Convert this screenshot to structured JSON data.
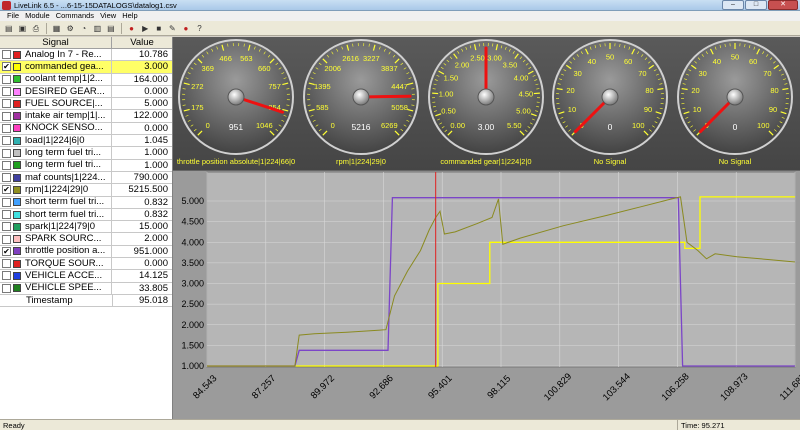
{
  "window": {
    "title": "LiveLink 6.5 - ...6-15-15DATALOGS\\datalog1.csv",
    "minimize": "–",
    "maximize": "□",
    "close": "✕"
  },
  "menu": [
    "File",
    "Module",
    "Commands",
    "View",
    "Help"
  ],
  "toolbar_icons": [
    "open-icon",
    "save-icon",
    "print-icon",
    "chart-icon",
    "config-icon",
    "gauge-icon",
    "table-icon",
    "log-icon",
    "record-icon",
    "play-icon",
    "stop-icon",
    "settings-icon",
    "record-dot-icon",
    "help-icon"
  ],
  "signal_table": {
    "headers": {
      "signal": "Signal",
      "value": "Value"
    },
    "rows": [
      {
        "checked": false,
        "color": "#e02020",
        "name": "Analog In 7 - Re...",
        "value": "10.786"
      },
      {
        "checked": true,
        "color": "#ffff00",
        "name": "commanded gea...",
        "value": "3.000",
        "selected": true
      },
      {
        "checked": false,
        "color": "#30c030",
        "name": "coolant temp|1|2...",
        "value": "164.000"
      },
      {
        "checked": false,
        "color": "#ff80ff",
        "name": "DESIRED GEAR...",
        "value": "0.000"
      },
      {
        "checked": false,
        "color": "#e02020",
        "name": "FUEL SOURCE|...",
        "value": "5.000"
      },
      {
        "checked": false,
        "color": "#a030a0",
        "name": "intake air temp|1|...",
        "value": "122.000"
      },
      {
        "checked": false,
        "color": "#ff40c0",
        "name": "KNOCK SENSO...",
        "value": "0.000"
      },
      {
        "checked": false,
        "color": "#30b0b0",
        "name": "load|1|224|6|0",
        "value": "1.045"
      },
      {
        "checked": false,
        "color": "#c0c0c0",
        "name": "long term fuel tri...",
        "value": "1.000"
      },
      {
        "checked": false,
        "color": "#20a020",
        "name": "long term fuel tri...",
        "value": "1.000"
      },
      {
        "checked": false,
        "color": "#4040a0",
        "name": "maf counts|1|224...",
        "value": "790.000"
      },
      {
        "checked": true,
        "color": "#8f8f20",
        "name": "rpm|1|224|29|0",
        "value": "5215.500"
      },
      {
        "checked": false,
        "color": "#40a0ff",
        "name": "short term fuel tri...",
        "value": "0.832"
      },
      {
        "checked": false,
        "color": "#40e0e0",
        "name": "short term fuel tri...",
        "value": "0.832"
      },
      {
        "checked": false,
        "color": "#20a060",
        "name": "spark|1|224|79|0",
        "value": "15.000"
      },
      {
        "checked": false,
        "color": "#ffc0c0",
        "name": "SPARK SOURC...",
        "value": "2.000"
      },
      {
        "checked": true,
        "color": "#8040c0",
        "name": "throttle position a...",
        "value": "951.000"
      },
      {
        "checked": false,
        "color": "#e02020",
        "name": "TORQUE SOUR...",
        "value": "0.000"
      },
      {
        "checked": false,
        "color": "#2040e0",
        "name": "VEHICLE ACCE...",
        "value": "14.125"
      },
      {
        "checked": false,
        "color": "#208020",
        "name": "VEHICLE SPEE...",
        "value": "33.805"
      }
    ],
    "timestamp": {
      "name": "Timestamp",
      "value": "95.018"
    }
  },
  "gauges": [
    {
      "label": "throttle position absolute|1|224|66|0",
      "readout": "951",
      "ticks": [
        "0",
        "175",
        "272",
        "369",
        "466",
        "563",
        "660",
        "757",
        "854",
        "1046"
      ],
      "needle_fraction": 0.9
    },
    {
      "label": "rpm|1|224|29|0",
      "readout": "5216",
      "ticks": [
        "0",
        "585",
        "1395",
        "2006",
        "2616",
        "3227",
        "3837",
        "4447",
        "5058",
        "6269"
      ],
      "needle_fraction": 0.83
    },
    {
      "label": "commanded gear|1|224|2|0",
      "readout": "3.00",
      "ticks": [
        "0.00",
        "0.50",
        "1.00",
        "1.50",
        "2.00",
        "2.50",
        "3.00",
        "3.50",
        "4.00",
        "4.50",
        "5.00",
        "5.50"
      ],
      "needle_fraction": 0.5
    },
    {
      "label": "No Signal",
      "readout": "0",
      "ticks": [
        "0",
        "10",
        "20",
        "30",
        "40",
        "50",
        "60",
        "70",
        "80",
        "90",
        "100"
      ],
      "needle_fraction": 0.0
    },
    {
      "label": "No Signal",
      "readout": "0",
      "ticks": [
        "0",
        "10",
        "20",
        "30",
        "40",
        "50",
        "60",
        "70",
        "80",
        "90",
        "100"
      ],
      "needle_fraction": 0.0
    }
  ],
  "chart_data": {
    "type": "line",
    "xlabel": "",
    "ylabel": "",
    "xlim": [
      84.543,
      111.687
    ],
    "ylim": [
      1.0,
      5.0
    ],
    "y_ticks": [
      "1.000",
      "1.500",
      "2.000",
      "2.500",
      "3.000",
      "3.500",
      "4.000",
      "4.500",
      "5.000"
    ],
    "x_ticks": [
      "84.543",
      "87.257",
      "89.972",
      "92.686",
      "95.401",
      "98.115",
      "100.829",
      "103.544",
      "106.258",
      "108.973",
      "111.687"
    ],
    "cursor_x": 95.1,
    "series": [
      {
        "color": "#ffff00",
        "points": [
          [
            84.543,
            1.0
          ],
          [
            95.2,
            1.0
          ],
          [
            95.2,
            3.0
          ],
          [
            97.6,
            3.0
          ],
          [
            97.6,
            4.0
          ],
          [
            106.6,
            4.0
          ],
          [
            106.6,
            3.85
          ],
          [
            107.3,
            3.85
          ],
          [
            107.3,
            5.1
          ],
          [
            111.687,
            5.1
          ]
        ]
      },
      {
        "color": "#7b45c8",
        "points": [
          [
            84.543,
            1.0
          ],
          [
            88.6,
            1.0
          ],
          [
            88.8,
            1.38
          ],
          [
            92.9,
            1.38
          ],
          [
            93.1,
            5.08
          ],
          [
            106.3,
            5.08
          ],
          [
            106.5,
            1.0
          ],
          [
            111.687,
            1.0
          ]
        ]
      },
      {
        "color": "#8a8a20",
        "points": [
          [
            84.543,
            1.0
          ],
          [
            88.6,
            1.0
          ],
          [
            88.8,
            1.75
          ],
          [
            89.5,
            1.78
          ],
          [
            91.0,
            1.82
          ],
          [
            92.8,
            1.88
          ],
          [
            93.2,
            2.7
          ],
          [
            93.8,
            3.3
          ],
          [
            94.4,
            3.8
          ],
          [
            94.8,
            4.3
          ],
          [
            95.1,
            4.6
          ],
          [
            95.3,
            4.75
          ],
          [
            95.5,
            4.2
          ],
          [
            96.0,
            4.25
          ],
          [
            97.0,
            4.45
          ],
          [
            97.7,
            4.6
          ],
          [
            98.0,
            5.05
          ],
          [
            98.2,
            3.95
          ],
          [
            99.0,
            4.1
          ],
          [
            101.0,
            4.4
          ],
          [
            103.0,
            4.65
          ],
          [
            104.5,
            4.85
          ],
          [
            106.0,
            5.05
          ],
          [
            106.4,
            5.1
          ],
          [
            106.7,
            4.0
          ],
          [
            107.2,
            3.8
          ],
          [
            107.6,
            3.6
          ],
          [
            108.0,
            3.72
          ],
          [
            109.0,
            3.65
          ],
          [
            110.5,
            3.58
          ],
          [
            111.687,
            3.52
          ]
        ]
      }
    ]
  },
  "status": {
    "left": "Ready",
    "time": "Time: 95.271"
  }
}
